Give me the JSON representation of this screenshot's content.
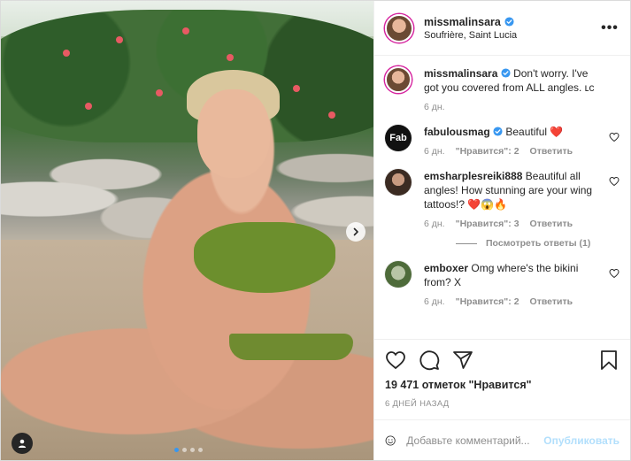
{
  "post": {
    "username": "missmalinsara",
    "location": "Soufrière, Saint Lucia",
    "more_label": "•••"
  },
  "caption": {
    "username": "missmalinsara",
    "text": "Don't worry. I've got you covered from ALL angles. ʟᴄ",
    "time": "6 дн."
  },
  "comments": [
    {
      "username": "fabulousmag",
      "avatar_text": "Fab",
      "text": "Beautiful ❤️",
      "time": "6 дн.",
      "likes": "\"Нравится\": 2",
      "reply_label": "Ответить",
      "verified": true
    },
    {
      "username": "emsharplesreiki888",
      "text": "Beautiful all angles! How stunning are your wing tattoos!? ❤️😱🔥",
      "time": "6 дн.",
      "likes": "\"Нравится\": 3",
      "reply_label": "Ответить",
      "verified": false
    },
    {
      "username": "emboxer",
      "text": "Omg where's the bikini from? X",
      "time": "6 дн.",
      "likes": "\"Нравится\": 2",
      "reply_label": "Ответить",
      "verified": false
    }
  ],
  "view_replies": "Посмотреть ответы (1)",
  "likes_count": "19 471 отметок \"Нравится\"",
  "posted_ago": "6 ДНЕЙ НАЗАД",
  "comment_box": {
    "placeholder": "Добавьте комментарий...",
    "publish_label": "Опубликовать"
  },
  "carousel": {
    "total": 4,
    "current": 1
  },
  "colors": {
    "accent": "#3897f0",
    "like_red": "#ed4956",
    "muted": "#8e8e8e",
    "publish_disabled": "#b2dffc"
  },
  "icons": [
    "next-chevron-icon",
    "tag-user-icon",
    "more-options-icon",
    "verified-badge-icon",
    "heart-icon",
    "comment-icon",
    "share-icon",
    "bookmark-icon",
    "emoji-icon"
  ]
}
